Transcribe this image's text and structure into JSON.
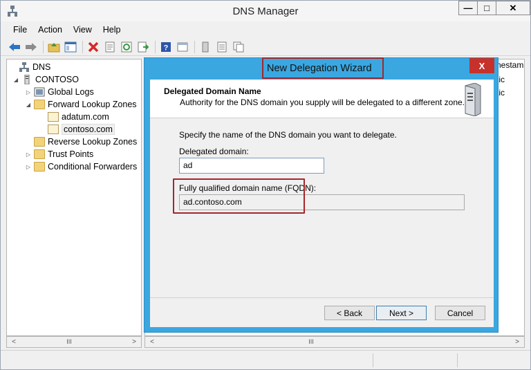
{
  "app": {
    "title": "DNS Manager"
  },
  "window_controls": {
    "minimize": "—",
    "maximize": "□",
    "close": "✕"
  },
  "menu": [
    "File",
    "Action",
    "View",
    "Help"
  ],
  "toolbar": {
    "icons": [
      "back-arrow-icon",
      "forward-arrow-icon",
      "up-folder-icon",
      "show-hide-tree-icon",
      "delete-icon",
      "properties-icon",
      "refresh-icon",
      "export-list-icon",
      "help-icon",
      "show-scope-icon",
      "server-icon",
      "list-icon",
      "copy-icon"
    ]
  },
  "tree": {
    "items": [
      {
        "label": "DNS",
        "expander": "",
        "icon": "dns-icon"
      },
      {
        "label": "CONTOSO",
        "expander": "◢",
        "icon": "server-icon"
      },
      {
        "label": "Global Logs",
        "expander": "▷",
        "icon": "logs-icon"
      },
      {
        "label": "Forward Lookup Zones",
        "expander": "◢",
        "icon": "folder-icon"
      },
      {
        "label": "adatum.com",
        "expander": "",
        "icon": "zone-icon"
      },
      {
        "label": "contoso.com",
        "expander": "",
        "icon": "zone-icon"
      },
      {
        "label": "Reverse Lookup Zones",
        "expander": "",
        "icon": "folder-icon"
      },
      {
        "label": "Trust Points",
        "expander": "▷",
        "icon": "folder-icon"
      },
      {
        "label": "Conditional Forwarders",
        "expander": "▷",
        "icon": "folder-icon"
      }
    ]
  },
  "scroll": {
    "left_arrow": "<",
    "right_arrow": ">",
    "grip": "III"
  },
  "right_pane": {
    "column_header": "nestam",
    "rows": [
      "tic",
      "tic"
    ]
  },
  "wizard": {
    "title": "New Delegation Wizard",
    "close": "X",
    "header_title": "Delegated Domain Name",
    "header_desc": "Authority for the DNS domain you supply will be delegated to a different zone.",
    "instruction": "Specify the name of the DNS domain you want to delegate.",
    "delegated_label": "Delegated domain:",
    "delegated_value": "ad",
    "fqdn_label": "Fully qualified domain name (FQDN):",
    "fqdn_value": "ad.contoso.com",
    "buttons": {
      "back": "< Back",
      "next": "Next >",
      "cancel": "Cancel"
    }
  },
  "colors": {
    "accent": "#3aa7e1",
    "highlight": "#a3262a",
    "close_red": "#c7312b"
  }
}
